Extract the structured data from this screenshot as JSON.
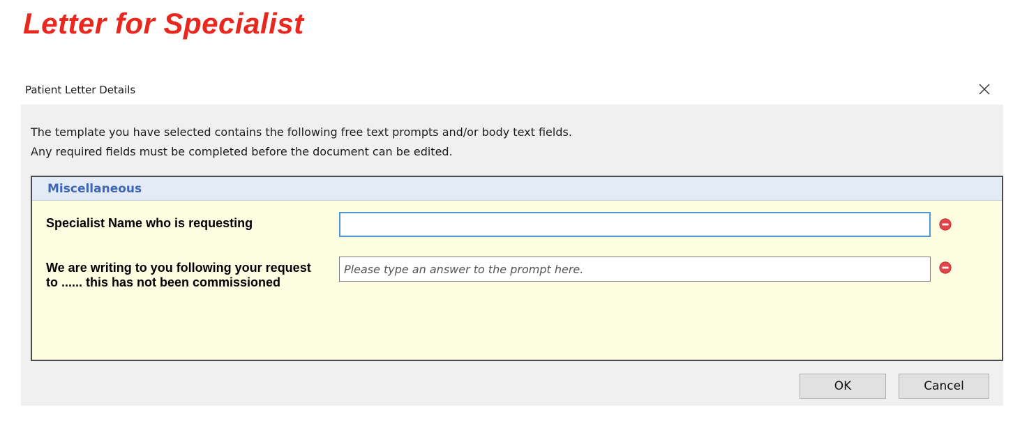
{
  "page_title": "Letter for Specialist",
  "dialog": {
    "title": "Patient Letter Details",
    "intro_line1": "The template you have selected contains the following free text prompts and/or body text fields.",
    "intro_line2": "Any required fields must be completed before the document can be edited.",
    "section_title": "Miscellaneous",
    "prompts": [
      {
        "label": "Specialist Name who is requesting",
        "value": "",
        "placeholder": ""
      },
      {
        "label": "We are writing to you following your request to ...... this has not been commissioned",
        "value": "",
        "placeholder": "Please type an answer to the prompt here."
      }
    ],
    "ok_label": "OK",
    "cancel_label": "Cancel"
  },
  "colors": {
    "title_red": "#e8281e",
    "section_blue": "#3d66b4",
    "panel_yellow": "#fdfde1",
    "focus_blue": "#4e96d6",
    "remove_red": "#e0454a"
  },
  "icons": {
    "close": "close-icon",
    "remove": "remove-icon"
  }
}
